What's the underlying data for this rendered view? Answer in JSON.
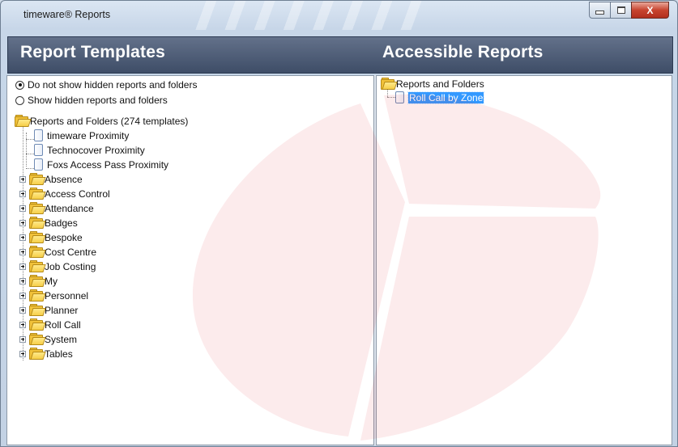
{
  "window": {
    "title": "timeware® Reports",
    "controls": {
      "minimize": "minimize",
      "maximize": "maximize",
      "close": "X"
    }
  },
  "header": {
    "left_title": "Report Templates",
    "right_title": "Accessible Reports"
  },
  "left_pane": {
    "options": [
      {
        "label": "Do not show hidden reports and folders",
        "selected": true
      },
      {
        "label": "Show hidden reports and folders",
        "selected": false
      }
    ],
    "root": {
      "label": "Reports and Folders (274 templates)"
    },
    "templates": [
      {
        "label": "timeware Proximity"
      },
      {
        "label": "Technocover Proximity"
      },
      {
        "label": "Foxs Access Pass Proximity"
      }
    ],
    "folders": [
      {
        "label": "Absence"
      },
      {
        "label": "Access Control"
      },
      {
        "label": "Attendance"
      },
      {
        "label": "Badges"
      },
      {
        "label": "Bespoke"
      },
      {
        "label": "Cost Centre"
      },
      {
        "label": "Job Costing"
      },
      {
        "label": "My"
      },
      {
        "label": "Personnel"
      },
      {
        "label": "Planner"
      },
      {
        "label": "Roll Call"
      },
      {
        "label": "System"
      },
      {
        "label": "Tables"
      }
    ]
  },
  "right_pane": {
    "root": {
      "label": "Reports and Folders"
    },
    "items": [
      {
        "label": "Roll Call by Zone",
        "selected": true
      }
    ]
  },
  "colors": {
    "header_bg": "#4e5c75",
    "selection": "#3399ff",
    "watermark": "#e3262d",
    "folder": "#f1c23a"
  }
}
